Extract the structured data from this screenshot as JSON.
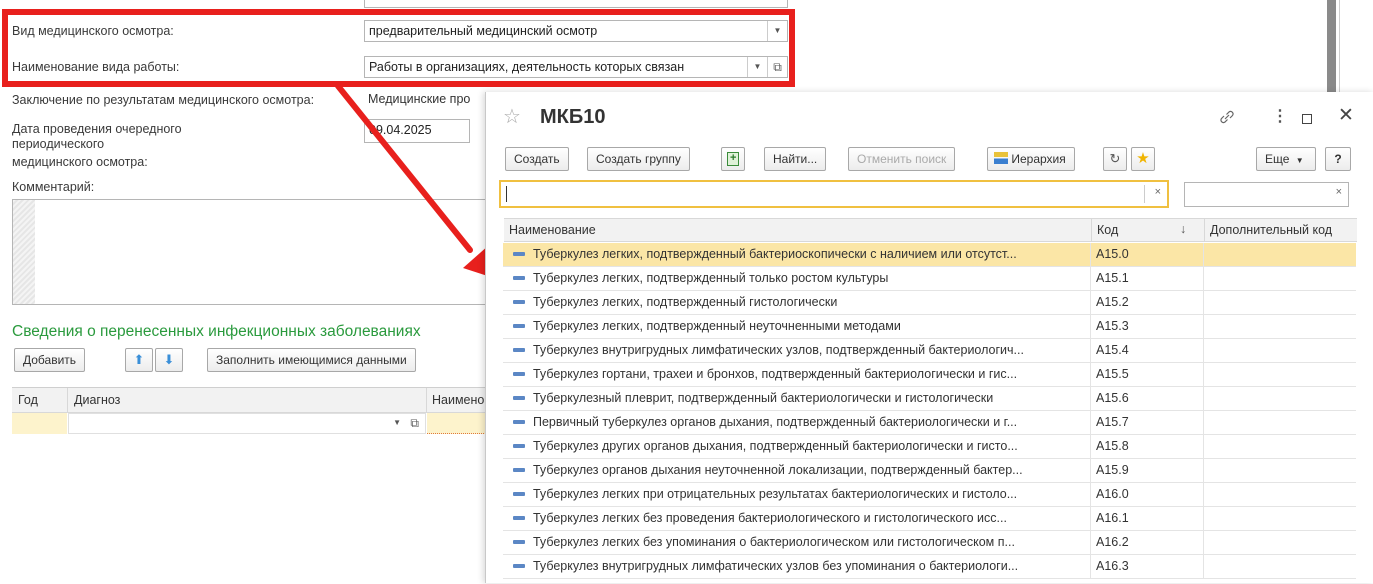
{
  "form": {
    "exam_type_label": "Вид медицинского осмотра:",
    "exam_type_value": "предварительный медицинский осмотр",
    "work_type_label": "Наименование вида работы:",
    "work_type_value": "Работы в организациях, деятельность которых связан",
    "conclusion_label": "Заключение по результатам медицинского осмотра:",
    "conclusion_value": "Медицинские про",
    "next_date_label_1": "Дата проведения очередного",
    "next_date_label_2": "периодического",
    "next_date_label_3": "медицинского осмотра:",
    "next_date_value": "09.04.2025",
    "comment_label": "Комментарий:"
  },
  "infections": {
    "title": "Сведения о перенесенных инфекционных заболеваниях",
    "add_button": "Добавить",
    "fill_button": "Заполнить имеющимися данными",
    "columns": {
      "year": "Год",
      "diagnosis": "Диагноз",
      "name": "Наимено"
    }
  },
  "dialog": {
    "title": "МКБ10",
    "toolbar": {
      "create": "Создать",
      "create_group": "Создать группу",
      "find": "Найти...",
      "cancel_search": "Отменить поиск",
      "hierarchy": "Иерархия",
      "more": "Еще",
      "help": "?"
    },
    "search_value": "",
    "columns": {
      "name": "Наименование",
      "code": "Код",
      "extra": "Дополнительный код"
    },
    "rows": [
      {
        "name": "Туберкулез легких, подтвержденный бактериоскопически с наличием или отсутст...",
        "code": "A15.0"
      },
      {
        "name": "Туберкулез легких, подтвержденный только ростом культуры",
        "code": "A15.1"
      },
      {
        "name": "Туберкулез легких, подтвержденный гистологически",
        "code": "A15.2"
      },
      {
        "name": "Туберкулез легких, подтвержденный неуточненными методами",
        "code": "A15.3"
      },
      {
        "name": "Туберкулез внутригрудных лимфатических узлов, подтвержденный бактериологич...",
        "code": "A15.4"
      },
      {
        "name": "Туберкулез гортани, трахеи и бронхов, подтвержденный бактериологически и гис...",
        "code": "A15.5"
      },
      {
        "name": "Туберкулезный плеврит, подтвержденный бактериологически и гистологически",
        "code": "A15.6"
      },
      {
        "name": "Первичный туберкулез органов дыхания, подтвержденный бактериологически и г...",
        "code": "A15.7"
      },
      {
        "name": "Туберкулез других органов дыхания, подтвержденный бактериологически и гисто...",
        "code": "A15.8"
      },
      {
        "name": "Туберкулез органов дыхания неуточненной локализации, подтвержденный бактер...",
        "code": "A15.9"
      },
      {
        "name": "Туберкулез легких при отрицательных результатах бактериологических и гистоло...",
        "code": "A16.0"
      },
      {
        "name": "Туберкулез легких без проведения бактериологического и гистологического исс...",
        "code": "A16.1"
      },
      {
        "name": "Туберкулез легких без упоминания о бактериологическом или гистологическом п...",
        "code": "A16.2"
      },
      {
        "name": "Туберкулез внутригрудных лимфатических узлов без упоминания о бактериологи...",
        "code": "A16.3"
      }
    ]
  },
  "colors": {
    "highlight_red": "#e8201d",
    "selected_row": "#fbe6a6",
    "section_green": "#2a9a3d",
    "search_border": "#f0c040",
    "dash_icon": "#5b87c5"
  }
}
